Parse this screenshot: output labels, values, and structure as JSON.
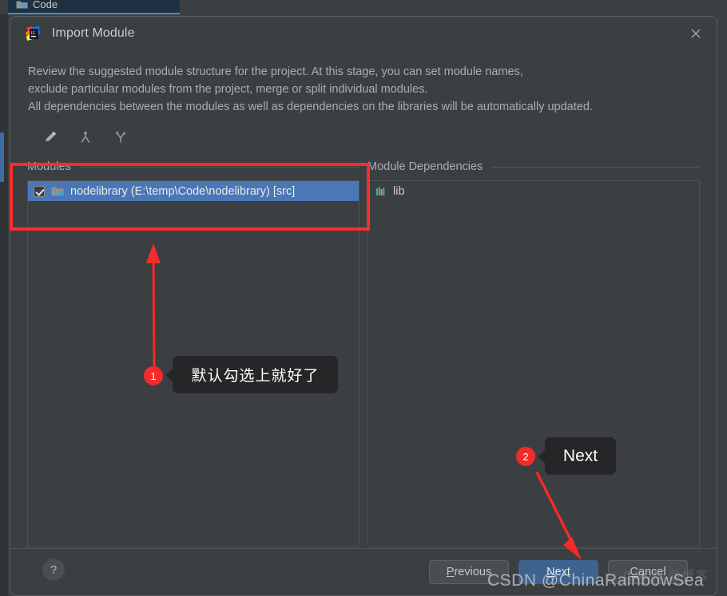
{
  "ide": {
    "tab_label": "Code",
    "tab_icon": "folder-icon"
  },
  "dialog": {
    "icon": "intellij-idea-logo-icon",
    "title": "Import Module",
    "close_icon": "close-icon",
    "description": [
      "Review the suggested module structure for the project. At this stage, you can set module names,",
      "exclude particular modules from the project, merge or split individual modules.",
      "All dependencies between the modules as well as dependencies on the libraries will be automatically updated."
    ],
    "toolbar": [
      {
        "name": "edit-pencil-icon",
        "title": "Rename"
      },
      {
        "name": "merge-modules-icon",
        "title": "Merge"
      },
      {
        "name": "split-module-icon",
        "title": "Split"
      }
    ],
    "panels": {
      "modules": {
        "title": "Modules",
        "rows": [
          {
            "checked": true,
            "icon": "module-folder-icon",
            "label": "nodelibrary (E:\\temp\\Code\\nodelibrary) [src]",
            "selected": true
          }
        ]
      },
      "dependencies": {
        "title": "Module Dependencies",
        "rows": [
          {
            "icon": "library-icon",
            "label": "lib"
          }
        ]
      }
    },
    "footer": {
      "help_label": "?",
      "help_icon": "question-mark-icon",
      "buttons": [
        {
          "name": "previous-button",
          "mnemonic": "P",
          "rest": "revious",
          "primary": false
        },
        {
          "name": "next-button",
          "mnemonic": "N",
          "rest": "ext",
          "primary": true
        },
        {
          "name": "cancel-button",
          "mnemonic": "C",
          "rest": "ancel",
          "primary": false
        }
      ]
    }
  },
  "annotations": {
    "accent_color": "#f32b2b",
    "callout1": {
      "badge": "1",
      "text": "默认勾选上就好了"
    },
    "callout2": {
      "badge": "2",
      "text": "Next"
    }
  },
  "watermark": {
    "text": "CSDN @ChinaRainbowSea",
    "faint_text": "CSDN @博客"
  }
}
